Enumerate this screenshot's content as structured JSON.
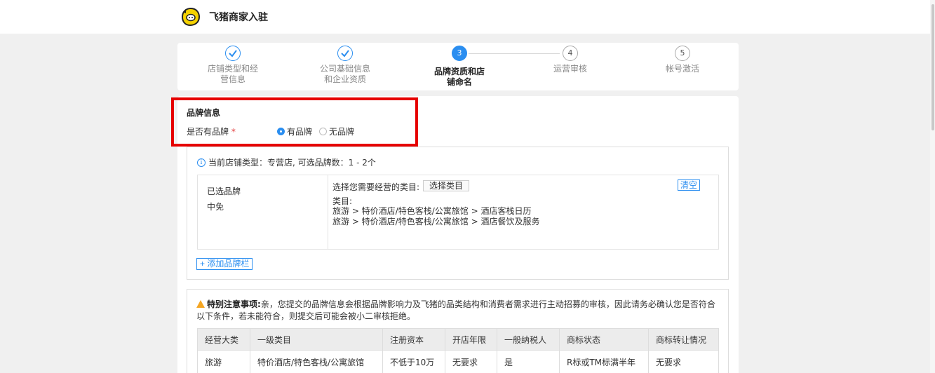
{
  "header": {
    "title": "飞猪商家入驻",
    "logo_icon": "pig-logo-icon"
  },
  "colors": {
    "accent": "#2b8ef0",
    "highlight": "#e60000",
    "warning": "#f5a623"
  },
  "steps": [
    {
      "number": "1",
      "label_line1": "店铺类型和经",
      "label_line2": "营信息",
      "status": "done"
    },
    {
      "number": "2",
      "label_line1": "公司基础信息",
      "label_line2": "和企业资质",
      "status": "done"
    },
    {
      "number": "3",
      "label_line1": "品牌资质和店",
      "label_line2": "铺命名",
      "status": "active"
    },
    {
      "number": "4",
      "label_line1": "运营审核",
      "label_line2": "",
      "status": "pending"
    },
    {
      "number": "5",
      "label_line1": "帐号激活",
      "label_line2": "",
      "status": "pending"
    }
  ],
  "brand_info": {
    "section_title": "品牌信息",
    "has_brand_label": "是否有品牌",
    "required_mark": "*",
    "options": [
      {
        "label": "有品牌",
        "checked": true
      },
      {
        "label": "无品牌",
        "checked": false
      }
    ]
  },
  "brand_panel": {
    "info_text": "当前店铺类型：专营店, 可选品牌数：1 - 2个",
    "selected_brand_label": "已选品牌",
    "selected_brand_name": "中免",
    "choose_category_label": "选择您需要经营的类目:",
    "choose_category_button": "选择类目",
    "clear_button": "清空",
    "category_label": "类目:",
    "categories": [
      "旅游 > 特价酒店/特色客栈/公寓旅馆 > 酒店客栈日历",
      "旅游 > 特价酒店/特色客栈/公寓旅馆 > 酒店餐饮及服务"
    ],
    "add_brand_button": "+ 添加品牌栏"
  },
  "notice": {
    "title": "特别注意事项:",
    "text": "亲，您提交的品牌信息会根据品牌影响力及飞猪的品类结构和消费者需求进行主动招募的审核，因此请务必确认您是否符合以下条件，若未能符合，则提交后可能会被小二审核拒绝。"
  },
  "requirements_table": {
    "headers": [
      "经营大类",
      "一级类目",
      "注册资本",
      "开店年限",
      "一般纳税人",
      "商标状态",
      "商标转让情况"
    ],
    "rows": [
      [
        "旅游",
        "特价酒店/特色客栈/公寓旅馆",
        "不低于10万",
        "无要求",
        "是",
        "R标或TM标满半年",
        "无要求"
      ]
    ]
  }
}
